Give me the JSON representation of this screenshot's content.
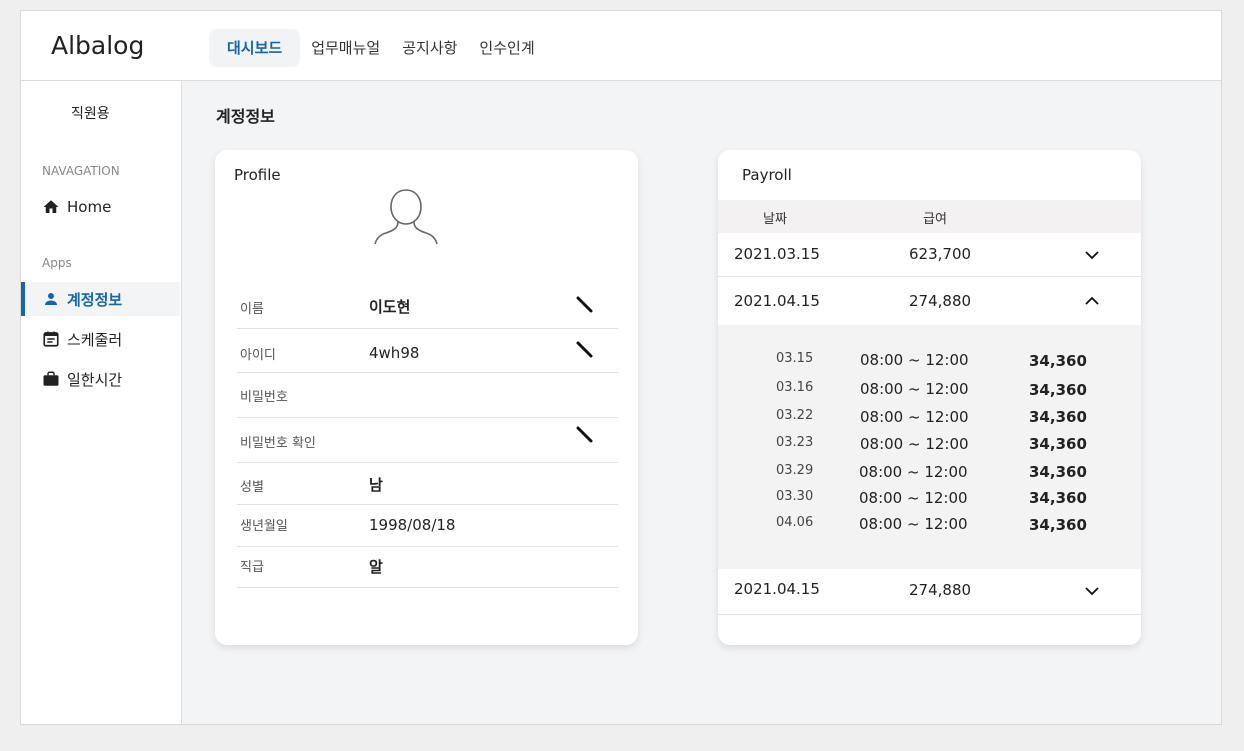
{
  "app": {
    "brand": "Albalog"
  },
  "nav": {
    "tabs": [
      "대시보드",
      "업무매뉴얼",
      "공지사항",
      "인수인계"
    ],
    "active_index": 0
  },
  "sidebar": {
    "role": "직원용",
    "section_nav": "NAVAGATION",
    "home": "Home",
    "section_apps": "Apps",
    "items": [
      {
        "label": "계정정보",
        "icon": "person-icon",
        "active": true
      },
      {
        "label": "스케줄러",
        "icon": "calendar-icon",
        "active": false
      },
      {
        "label": "일한시간",
        "icon": "briefcase-icon",
        "active": false
      }
    ]
  },
  "page": {
    "title": "계정정보"
  },
  "profile": {
    "title": "Profile",
    "fields": [
      {
        "label": "이름",
        "value": "이도현",
        "editable": true
      },
      {
        "label": "아이디",
        "value": "4wh98",
        "editable": true
      },
      {
        "label": "비밀번호",
        "value": "",
        "editable": false
      },
      {
        "label": "비밀번호 확인",
        "value": "",
        "editable": true
      },
      {
        "label": "성별",
        "value": "남",
        "editable": false
      },
      {
        "label": "생년월일",
        "value": "1998/08/18",
        "editable": false
      },
      {
        "label": "직급",
        "value": "알",
        "editable": false
      }
    ]
  },
  "payroll": {
    "title": "Payroll",
    "col_date": "날짜",
    "col_amount": "급여",
    "rows": [
      {
        "date": "2021.03.15",
        "amount": "623,700",
        "expanded": false
      },
      {
        "date": "2021.04.15",
        "amount": "274,880",
        "expanded": true
      },
      {
        "date": "2021.04.15",
        "amount": "274,880",
        "expanded": false
      }
    ],
    "details": [
      {
        "day": "03.15",
        "time": "08:00 ~ 12:00",
        "pay": "34,360"
      },
      {
        "day": "03.16",
        "time": "08:00 ~ 12:00",
        "pay": "34,360"
      },
      {
        "day": "03.22",
        "time": "08:00 ~ 12:00",
        "pay": "34,360"
      },
      {
        "day": "03.23",
        "time": "08:00 ~ 12:00",
        "pay": "34,360"
      },
      {
        "day": "03.29",
        "time": "08:00 ~ 12:00",
        "pay": "34,360"
      },
      {
        "day": "03.30",
        "time": "08:00 ~ 12:00",
        "pay": "34,360"
      },
      {
        "day": "04.06",
        "time": "08:00 ~ 12:00",
        "pay": "34,360"
      }
    ]
  },
  "colors": {
    "accent": "#1565a8",
    "background": "#f3f4f6"
  }
}
